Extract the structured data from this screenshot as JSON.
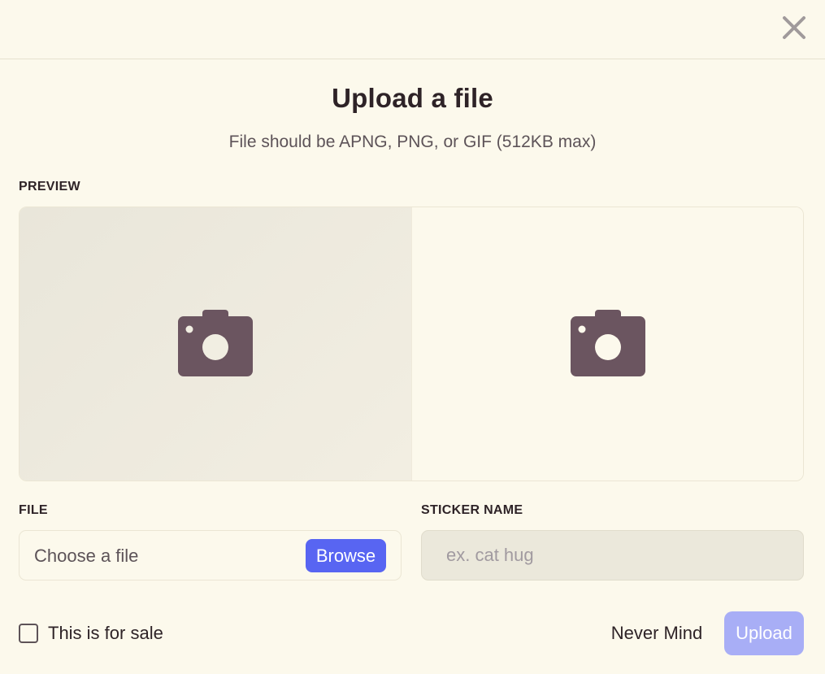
{
  "dialog": {
    "title": "Upload a file",
    "subtitle": "File should be APNG, PNG, or GIF (512KB max)",
    "close_icon": "close-icon"
  },
  "preview": {
    "label": "PREVIEW",
    "light_icon": "camera-icon",
    "dark_icon": "camera-icon"
  },
  "file": {
    "label": "FILE",
    "placeholder": "Choose a file",
    "browse_label": "Browse"
  },
  "sticker_name": {
    "label": "STICKER NAME",
    "placeholder": "ex. cat hug",
    "value": ""
  },
  "footer": {
    "sale_label": "This is for sale",
    "sale_checked": false,
    "cancel_label": "Never Mind",
    "upload_label": "Upload"
  },
  "colors": {
    "background": "#fcf9ec",
    "accent": "#5865f2",
    "accent_disabled": "#a8aef6",
    "icon": "#6b5560",
    "text": "#2e2327",
    "muted_text": "#5d5358"
  }
}
